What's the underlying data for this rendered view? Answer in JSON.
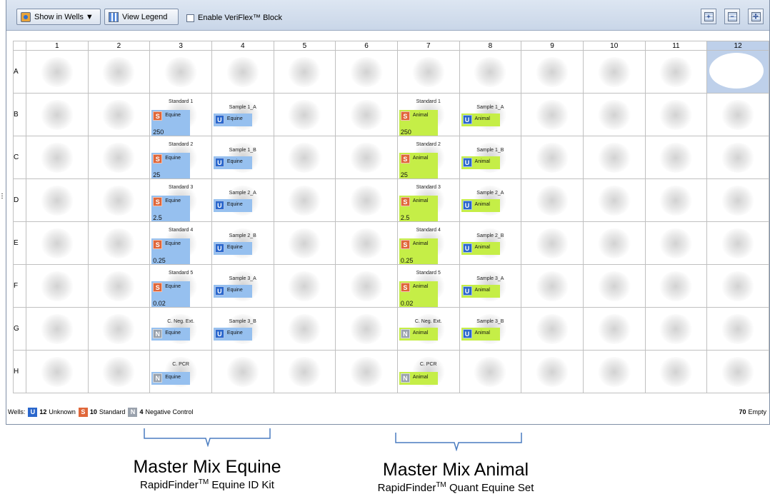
{
  "toolbar": {
    "show_in_wells": "Show in Wells ▼",
    "view_legend": "View Legend",
    "enable_veriflex": "Enable VeriFlex™ Block"
  },
  "plate": {
    "columns": [
      "1",
      "2",
      "3",
      "4",
      "5",
      "6",
      "7",
      "8",
      "9",
      "10",
      "11",
      "12"
    ],
    "rows": [
      "A",
      "B",
      "C",
      "D",
      "E",
      "F",
      "G",
      "H"
    ],
    "selected_column": "12",
    "selected_well": "A12",
    "wells": {
      "B3": {
        "title": "Standard 1",
        "task": "S",
        "target": "Equine",
        "quantity": "250",
        "mix": "equine"
      },
      "C3": {
        "title": "Standard 2",
        "task": "S",
        "target": "Equine",
        "quantity": "25",
        "mix": "equine"
      },
      "D3": {
        "title": "Standard 3",
        "task": "S",
        "target": "Equine",
        "quantity": "2.5",
        "mix": "equine"
      },
      "E3": {
        "title": "Standard 4",
        "task": "S",
        "target": "Equine",
        "quantity": "0.25",
        "mix": "equine"
      },
      "F3": {
        "title": "Standard 5",
        "task": "S",
        "target": "Equine",
        "quantity": "0.02",
        "mix": "equine"
      },
      "G3": {
        "title": "C. Neg. Ext.",
        "task": "N",
        "target": "Equine",
        "quantity": "",
        "mix": "equine"
      },
      "H3": {
        "title": "C. PCR",
        "task": "N",
        "target": "Equine",
        "quantity": "",
        "mix": "equine"
      },
      "B4": {
        "title": "Sample 1_A",
        "task": "U",
        "target": "Equine",
        "quantity": "",
        "mix": "equine"
      },
      "C4": {
        "title": "Sample 1_B",
        "task": "U",
        "target": "Equine",
        "quantity": "",
        "mix": "equine"
      },
      "D4": {
        "title": "Sample 2_A",
        "task": "U",
        "target": "Equine",
        "quantity": "",
        "mix": "equine"
      },
      "E4": {
        "title": "Sample 2_B",
        "task": "U",
        "target": "Equine",
        "quantity": "",
        "mix": "equine"
      },
      "F4": {
        "title": "Sample 3_A",
        "task": "U",
        "target": "Equine",
        "quantity": "",
        "mix": "equine"
      },
      "G4": {
        "title": "Sample 3_B",
        "task": "U",
        "target": "Equine",
        "quantity": "",
        "mix": "equine"
      },
      "B7": {
        "title": "Standard 1",
        "task": "S",
        "target": "Animal",
        "quantity": "250",
        "mix": "animal"
      },
      "C7": {
        "title": "Standard 2",
        "task": "S",
        "target": "Animal",
        "quantity": "25",
        "mix": "animal"
      },
      "D7": {
        "title": "Standard 3",
        "task": "S",
        "target": "Animal",
        "quantity": "2.5",
        "mix": "animal"
      },
      "E7": {
        "title": "Standard 4",
        "task": "S",
        "target": "Animal",
        "quantity": "0.25",
        "mix": "animal"
      },
      "F7": {
        "title": "Standard 5",
        "task": "S",
        "target": "Animal",
        "quantity": "0.02",
        "mix": "animal"
      },
      "G7": {
        "title": "C. Neg. Ext.",
        "task": "N",
        "target": "Animal",
        "quantity": "",
        "mix": "animal"
      },
      "H7": {
        "title": "C. PCR",
        "task": "N",
        "target": "Animal",
        "quantity": "",
        "mix": "animal"
      },
      "B8": {
        "title": "Sample 1_A",
        "task": "U",
        "target": "Animal",
        "quantity": "",
        "mix": "animal"
      },
      "C8": {
        "title": "Sample 1_B",
        "task": "U",
        "target": "Animal",
        "quantity": "",
        "mix": "animal"
      },
      "D8": {
        "title": "Sample 2_A",
        "task": "U",
        "target": "Animal",
        "quantity": "",
        "mix": "animal"
      },
      "E8": {
        "title": "Sample 2_B",
        "task": "U",
        "target": "Animal",
        "quantity": "",
        "mix": "animal"
      },
      "F8": {
        "title": "Sample 3_A",
        "task": "U",
        "target": "Animal",
        "quantity": "",
        "mix": "animal"
      },
      "G8": {
        "title": "Sample 3_B",
        "task": "U",
        "target": "Animal",
        "quantity": "",
        "mix": "animal"
      }
    }
  },
  "colors": {
    "equine_task": "#96c0ef",
    "animal_task": "#c5ee47",
    "standard": "#e0673a",
    "unknown": "#2b67cc",
    "negative_control": "#9aa2ad",
    "selection": "#bed0ea"
  },
  "status": {
    "wells_label": "Wells:",
    "unknown_count": "12",
    "unknown_label": "Unknown",
    "standard_count": "10",
    "standard_label": "Standard",
    "negative_count": "4",
    "negative_label": "Negative Control",
    "empty_count": "70",
    "empty_label": "Empty"
  },
  "annotations": {
    "equine": {
      "main": "Master Mix Equine",
      "sub_prefix": "RapidFinder",
      "sub_tm": "TM",
      "sub_suffix": " Equine ID Kit"
    },
    "animal": {
      "main": "Master Mix Animal",
      "sub_prefix": "RapidFinder",
      "sub_tm": "TM",
      "sub_suffix": " Quant Equine Set"
    }
  }
}
